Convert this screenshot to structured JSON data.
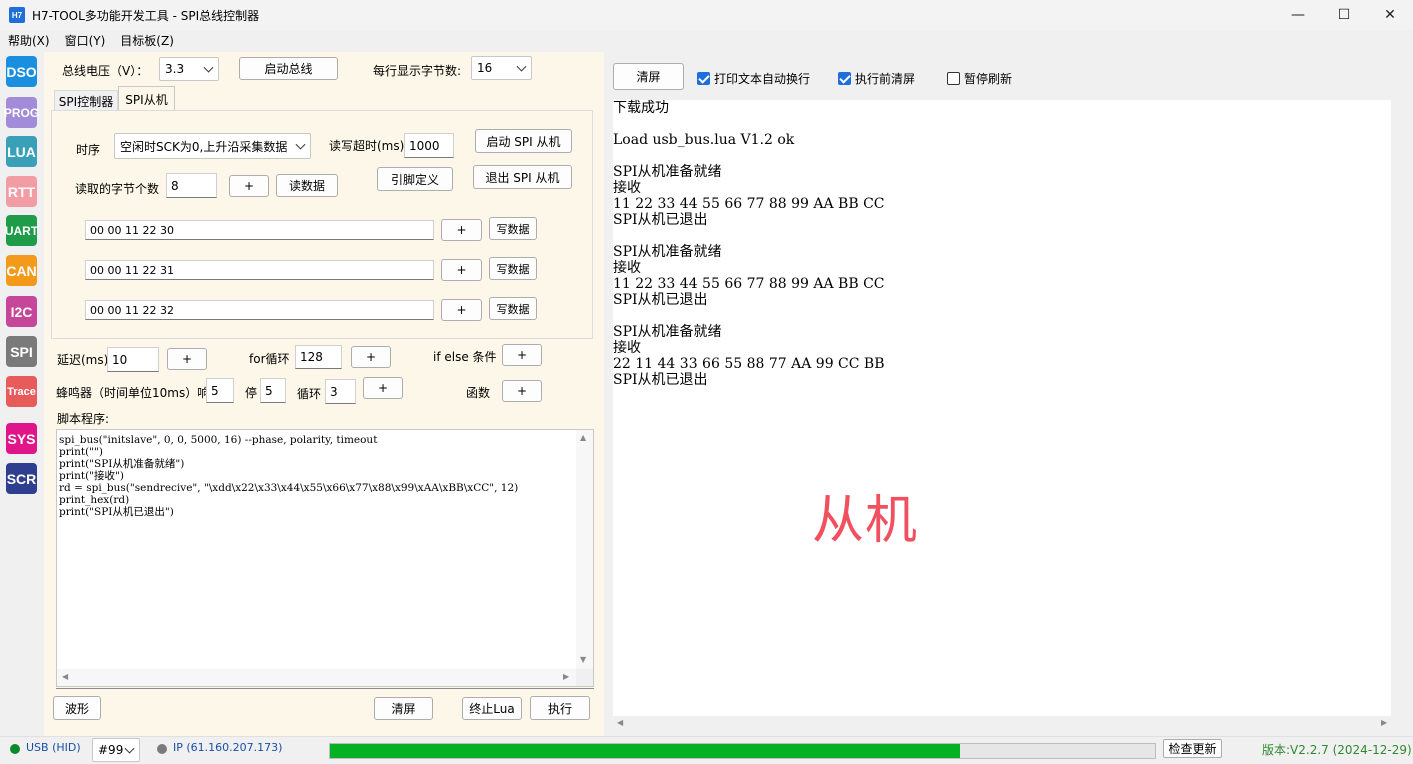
{
  "window": {
    "icon_label": "H7",
    "title": "H7-TOOL多功能开发工具 - SPI总线控制器",
    "minimize": "—",
    "maximize": "☐",
    "close": "✕"
  },
  "menu": [
    "帮助(X)",
    "窗口(Y)",
    "目标板(Z)"
  ],
  "sidebar": [
    {
      "label": "DSO",
      "color": "#1a8fe0"
    },
    {
      "label": "PROG",
      "color": "#a28bd8"
    },
    {
      "label": "LUA",
      "color": "#3aa0b8"
    },
    {
      "label": "RTT",
      "color": "#f29ca3"
    },
    {
      "label": "UART",
      "color": "#1f9c4a"
    },
    {
      "label": "CAN",
      "color": "#f39a1b"
    },
    {
      "label": "I2C",
      "color": "#c6469a"
    },
    {
      "label": "SPI",
      "color": "#7a7a7a"
    },
    {
      "label": "Trace",
      "color": "#e85b5b"
    },
    {
      "label": "SYS",
      "color": "#e0158a"
    },
    {
      "label": "SCR",
      "color": "#2e3f8f"
    }
  ],
  "top": {
    "voltage_label": "总线电压（V）：",
    "voltage_value": "3.3",
    "start_bus": "启动总线",
    "bytes_per_line_label": "每行显示字节数:",
    "bytes_per_line_value": "16"
  },
  "tabs": [
    "SPI控制器",
    "SPI从机"
  ],
  "spi_slave": {
    "timing_label": "时序",
    "timing_value": "空闲时SCK为0,上升沿采集数据",
    "timeout_label": "读写超时(ms)",
    "timeout_value": "1000",
    "start_slave": "启动 SPI 从机",
    "read_count_label": "读取的字节个数",
    "read_count_value": "8",
    "plus": "+",
    "read_data": "读数据",
    "pin_def": "引脚定义",
    "exit_slave": "退出 SPI 从机",
    "write_rows": [
      {
        "value": "00 00 11 22 30",
        "plus": "+",
        "write": "写数据"
      },
      {
        "value": "00 00 11 22 31",
        "plus": "+",
        "write": "写数据"
      },
      {
        "value": "00 00 11 22 32",
        "plus": "+",
        "write": "写数据"
      }
    ]
  },
  "helpers": {
    "delay_label": "延迟(ms)",
    "delay_value": "10",
    "for_label": "for循环",
    "for_value": "128",
    "ifelse_label": "if else 条件",
    "beep_label": "蜂鸣器（时间单位10ms）响",
    "beep_on": "5",
    "stop_label": "停",
    "beep_off": "5",
    "loop_label": "循环",
    "loop_value": "3",
    "func_label": "函数",
    "plus": "+"
  },
  "script": {
    "label": "脚本程序:",
    "code": "spi_bus(\"initslave\", 0, 0, 5000, 16) --phase, polarity, timeout\nprint(\"\")\nprint(\"SPI从机准备就绪\")\nprint(\"接收\")\nrd = spi_bus(\"sendrecive\", \"\\xdd\\x22\\x33\\x44\\x55\\x66\\x77\\x88\\x99\\xAA\\xBB\\xCC\", 12)\nprint_hex(rd)\nprint(\"SPI从机已退出\")"
  },
  "bottom_buttons": {
    "wave": "波形",
    "clear": "清屏",
    "stop_lua": "终止Lua",
    "run": "执行"
  },
  "output_toolbar": {
    "clear": "清屏",
    "auto_wrap": "打印文本自动换行",
    "auto_wrap_checked": true,
    "clear_before_run": "执行前清屏",
    "clear_before_run_checked": true,
    "pause_refresh": "暂停刷新",
    "pause_refresh_checked": false
  },
  "output_lines": [
    "下载成功",
    "",
    "Load usb_bus.lua V1.2 ok",
    "",
    "SPI从机准备就绪",
    "接收",
    "11 22 33 44 55 66 77 88 99 AA BB CC",
    "SPI从机已退出",
    "",
    "SPI从机准备就绪",
    "接收",
    "11 22 33 44 55 66 77 88 99 AA BB CC",
    "SPI从机已退出",
    "",
    "SPI从机准备就绪",
    "接收",
    "22 11 44 33 66 55 88 77 AA 99 CC BB",
    "SPI从机已退出"
  ],
  "watermark": "从机",
  "status": {
    "usb": "USB (HID)",
    "usb_color": "#0a8a2a",
    "device": "#99",
    "ip": "IP (61.160.207.173)",
    "ip_color": "#7a7a7a",
    "check_update": "检查更新",
    "version": "版本:V2.2.7 (2024-12-29)",
    "progress_fraction": 0.764,
    "progress_color": "#06b025"
  }
}
